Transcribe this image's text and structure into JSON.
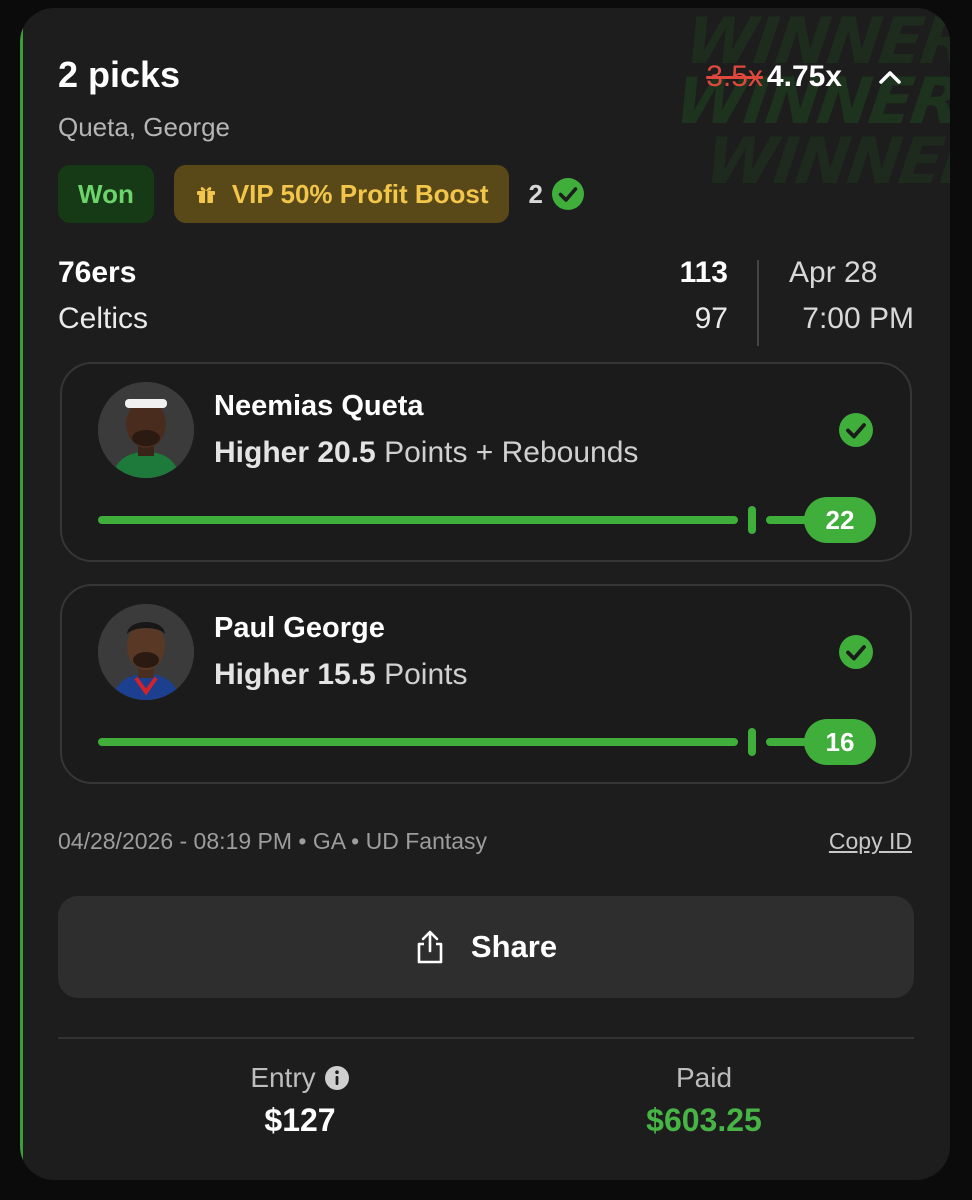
{
  "header": {
    "title": "2 picks",
    "subtitle": "Queta, George",
    "old_multiplier": "3.5x",
    "new_multiplier": "4.75x",
    "watermark_lines": [
      "WINNER!!",
      "WINNER!!",
      "WINNER!!"
    ]
  },
  "badges": {
    "status": "Won",
    "boost": "VIP 50% Profit Boost",
    "hits": "2"
  },
  "game": {
    "team1": "76ers",
    "team2": "Celtics",
    "score1": "113",
    "score2": "97",
    "date": "Apr 28",
    "time": "7:00 PM"
  },
  "picks": [
    {
      "player": "Neemias Queta",
      "direction_line": "Higher 20.5",
      "stat": "Points + Rebounds",
      "line": 20.5,
      "result": "22",
      "avatar_icon": "player-avatar-icon"
    },
    {
      "player": "Paul George",
      "direction_line": "Higher 15.5",
      "stat": "Points",
      "line": 15.5,
      "result": "16",
      "avatar_icon": "player-avatar-icon"
    }
  ],
  "meta": {
    "info": "04/28/2026 - 08:19 PM • GA • UD Fantasy",
    "copy_id": "Copy ID"
  },
  "share": {
    "label": "Share"
  },
  "footer": {
    "entry_label": "Entry",
    "entry_value": "$127",
    "paid_label": "Paid",
    "paid_value": "$603.25"
  },
  "colors": {
    "accent_green": "#3fae3b",
    "paid_green": "#47b545",
    "strike_red": "#e0483e",
    "vip_gold": "#f2c64a",
    "card_bg": "#1d1d1d"
  }
}
